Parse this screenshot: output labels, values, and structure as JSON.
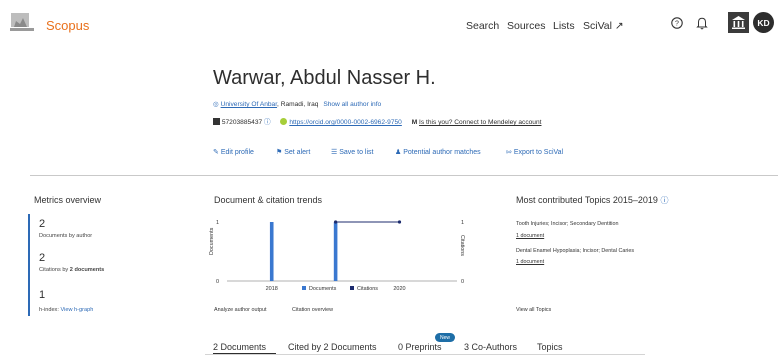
{
  "header": {
    "brand": "Scopus",
    "nav": [
      "Search",
      "Sources",
      "Lists",
      "SciVal ↗"
    ],
    "avatar_initials": "KD"
  },
  "author": {
    "name": "Warwar, Abdul Nasser H.",
    "affiliation": "University Of Anbar",
    "location": ", Ramadi, Iraq",
    "show_all": "Show all author info",
    "author_id": "57203885437",
    "orcid_url": "https://orcid.org/0000-0002-6962-9750",
    "mendeley": "Is this you? Connect to Mendeley account"
  },
  "actions": [
    "Edit profile",
    "Set alert",
    "Save to list",
    "Potential author matches",
    "Export to SciVal"
  ],
  "metrics": {
    "title": "Metrics overview",
    "documents_value": "2",
    "documents_label": "Documents by author",
    "citations_value": "2",
    "citations_label_pre": "Citations by ",
    "citations_label_bold": "2 documents",
    "hindex_value": "1",
    "hindex_label": "h-index:",
    "hindex_link": "View h-graph"
  },
  "trends": {
    "title": "Document & citation trends",
    "ylabel_left": "Documents",
    "ylabel_right": "Citations",
    "legend_documents": "Documents",
    "legend_citations": "Citations",
    "link_analyze": "Analyze author output",
    "link_citation": "Citation overview"
  },
  "chart_data": {
    "type": "bar",
    "x_tick_labels": [
      "2018",
      "2020"
    ],
    "x_range": [
      2017.3,
      2020.9
    ],
    "y_left_ticks": [
      "0",
      "1"
    ],
    "y_right_ticks": [
      "0",
      "1"
    ],
    "ylim": [
      0,
      1
    ],
    "series": [
      {
        "name": "Documents",
        "type": "bar",
        "color": "#3a78d0",
        "x": [
          2018,
          2019
        ],
        "values": [
          1,
          1
        ]
      },
      {
        "name": "Citations",
        "type": "line",
        "color": "#1c2b6e",
        "x": [
          2019,
          2020
        ],
        "values": [
          1,
          1
        ]
      }
    ]
  },
  "topics": {
    "title": "Most contributed Topics 2015–2019",
    "items": [
      {
        "name": "Tooth Injuries; Incisor; Secondary Dentition",
        "count": "1 document"
      },
      {
        "name": "Dental Enamel Hypoplasia; Incisor; Dental Caries",
        "count": "1 document"
      }
    ],
    "view_all": "View all Topics"
  },
  "tabs": [
    "2 Documents",
    "Cited by 2 Documents",
    "0 Preprints",
    "3 Co-Authors",
    "Topics"
  ],
  "new_badge": "New",
  "colors": {
    "brand": "#e9711c",
    "link": "#2d6ab6",
    "bar": "#3a78d0",
    "line": "#1c2b6e"
  }
}
